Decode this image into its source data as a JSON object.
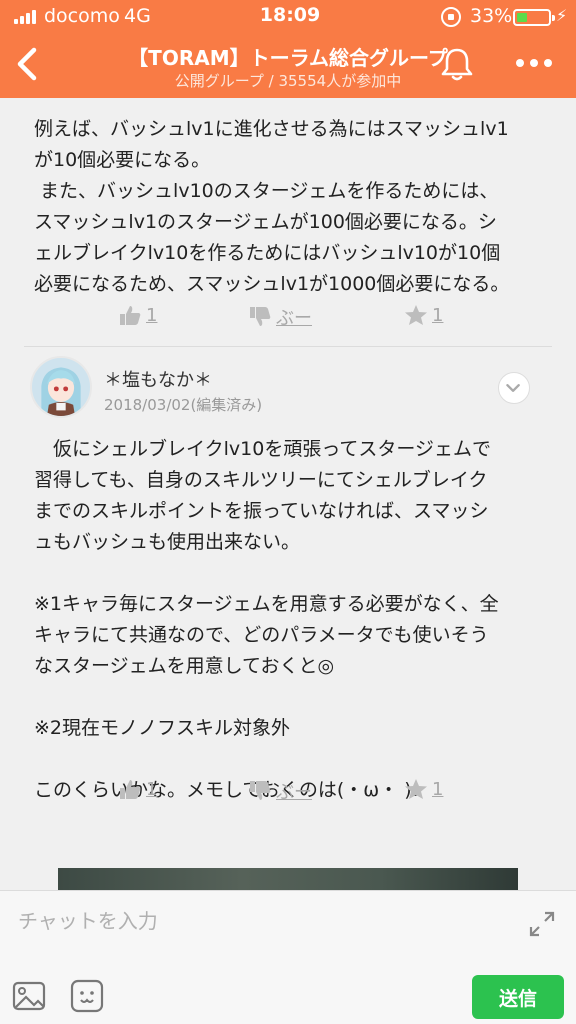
{
  "status": {
    "carrier": "docomo",
    "network": "4G",
    "time": "18:09",
    "battery": "33%",
    "battery_level": 0.33
  },
  "header": {
    "title": "【TORAM】トーラム総合グループ",
    "subtitle": "公開グループ / 35554人が参加中"
  },
  "messages": [
    {
      "text": "例えば、バッシュlv1に進化させる為にはスマッシュlv1\nが10個必要になる。\n また、バッシュlv10のスタージェムを作るためには、\nスマッシュlv1のスタージェムが100個必要になる。シ\nェルブレイクlv10を作るためにはバッシュlv10が10個\n必要になるため、スマッシュlv1が1000個必要になる。",
      "likes": "1",
      "dislike_label": "ぶー",
      "stars": "1"
    },
    {
      "author": "＊塩もなか＊",
      "date": "2018/03/02(編集済み)",
      "text": "　仮にシェルブレイクlv10を頑張ってスタージェムで\n習得しても、自身のスキルツリーにてシェルブレイク\nまでのスキルポイントを振っていなければ、スマッシ\nュもバッシュも使用出来ない。\n\n※1キャラ毎にスタージェムを用意する必要がなく、全\nキャラにて共通なので、どのパラメータでも使いそう\nなスタージェムを用意しておくと◎\n\n※2現在モノノフスキル対象外\n\nこのくらいかな。メモしておくのは(・ω・ )!",
      "likes": "1",
      "dislike_label": "ぶー",
      "stars": "1"
    }
  ],
  "input": {
    "placeholder": "チャットを入力",
    "send_label": "送信"
  },
  "colors": {
    "header": "#f97b45",
    "send": "#2cc24f",
    "reaction": "#a8a8a8"
  }
}
